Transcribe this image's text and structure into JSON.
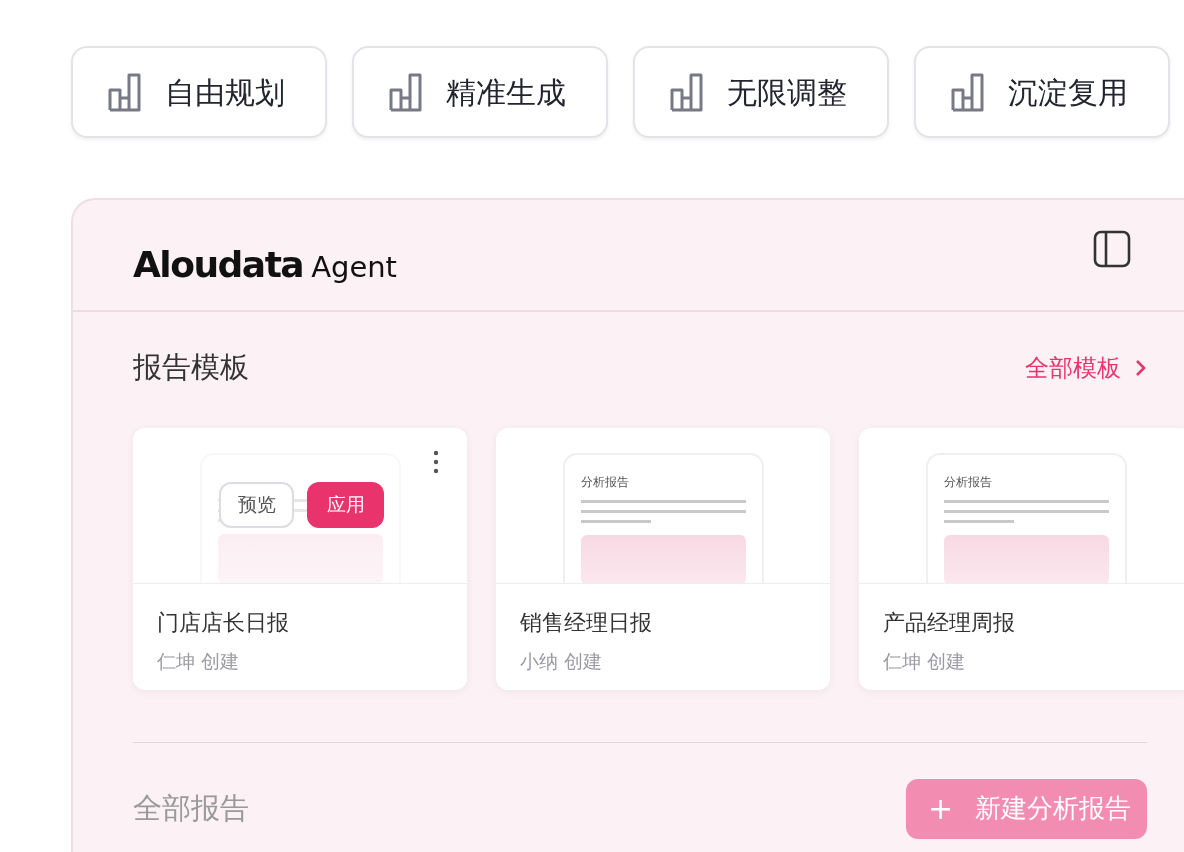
{
  "chips": [
    {
      "label": "自由规划"
    },
    {
      "label": "精准生成"
    },
    {
      "label": "无限调整"
    },
    {
      "label": "沉淀复用"
    }
  ],
  "panel": {
    "brand": {
      "name": "Aloudata",
      "suffix": "Agent"
    },
    "templates": {
      "title": "报告模板",
      "link": "全部模板",
      "cards": [
        {
          "name": "门店店长日报",
          "author": "仁坤 创建",
          "hovered": true,
          "actions": [
            "预览",
            "应用"
          ]
        },
        {
          "thumbnail_title": "分析报告",
          "name": "销售经理日报",
          "author": "小纳 创建",
          "hovered": false
        },
        {
          "thumbnail_title": "分析报告",
          "name": "产品经理周报",
          "author": "仁坤 创建",
          "hovered": false
        }
      ]
    },
    "reports": {
      "title": "全部报告",
      "new_button": {
        "icon": "+",
        "label": "新建分析报告"
      }
    }
  }
}
